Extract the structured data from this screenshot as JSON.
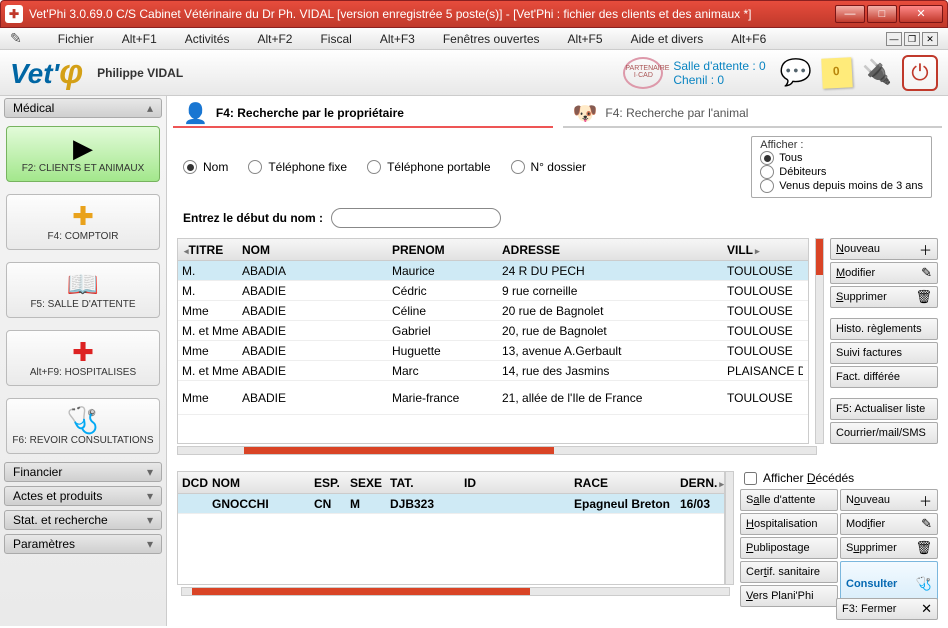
{
  "window": {
    "title": "Vet'Phi 3.0.69.0 C/S  Cabinet Vétérinaire du Dr Ph. VIDAL  [version enregistrée 5 poste(s)] - [Vet'Phi : fichier des clients et des animaux *]"
  },
  "menu": {
    "fichier": "Fichier",
    "alt_f1": "Alt+F1",
    "activites": "Activités",
    "alt_f2": "Alt+F2",
    "fiscal": "Fiscal",
    "alt_f3": "Alt+F3",
    "fenetres": "Fenêtres ouvertes",
    "alt_f5": "Alt+F5",
    "aide": "Aide et divers",
    "alt_f6": "Alt+F6"
  },
  "brand": {
    "logo1": "Vet'",
    "logo2": "φ",
    "user": "Philippe VIDAL",
    "salle": "Salle d'attente : 0",
    "chenil": "Chenil : 0"
  },
  "sidebar": {
    "medical": "Médical",
    "clients": "F2: CLIENTS ET ANIMAUX",
    "comptoir": "F4: COMPTOIR",
    "salle": "F5: SALLE D'ATTENTE",
    "hospit": "Alt+F9: HOSPITALISES",
    "revoir": "F6: REVOIR CONSULTATIONS",
    "financier": "Financier",
    "actes": "Actes et produits",
    "stat": "Stat. et recherche",
    "param": "Paramètres"
  },
  "search": {
    "tab1": "F4:  Recherche par le propriétaire",
    "tab2": "F4: Recherche par l'animal",
    "nom": "Nom",
    "telfixe": "Téléphone fixe",
    "telport": "Téléphone portable",
    "dossier": "N° dossier",
    "entrez": "Entrez le début du nom :",
    "afficher_lgd": "Afficher :",
    "tous": "Tous",
    "debit": "Débiteurs",
    "venus": "Venus depuis moins de 3 ans"
  },
  "clients_table": {
    "headers": {
      "titre": "TITRE",
      "nom": "NOM",
      "prenom": "PRENOM",
      "adresse": "ADRESSE",
      "ville": "VILL"
    },
    "rows": [
      {
        "titre": "M.",
        "nom": "ABADIA",
        "prenom": "Maurice",
        "adresse": "24 R DU PECH",
        "ville": "TOULOUSE"
      },
      {
        "titre": "M.",
        "nom": "ABADIE",
        "prenom": "Cédric",
        "adresse": "9 rue corneille",
        "ville": "TOULOUSE"
      },
      {
        "titre": "Mme",
        "nom": "ABADIE",
        "prenom": "Céline",
        "adresse": "20 rue de Bagnolet",
        "ville": "TOULOUSE"
      },
      {
        "titre": "M. et Mme",
        "nom": "ABADIE",
        "prenom": "Gabriel",
        "adresse": "20, rue de Bagnolet",
        "ville": "TOULOUSE"
      },
      {
        "titre": "Mme",
        "nom": "ABADIE",
        "prenom": "Huguette",
        "adresse": "13, avenue A.Gerbault",
        "ville": "TOULOUSE"
      },
      {
        "titre": "M. et Mme",
        "nom": "ABADIE",
        "prenom": "Marc",
        "adresse": "14, rue des Jasmins",
        "ville": "PLAISANCE DU"
      },
      {
        "titre": "Mme",
        "nom": "ABADIE",
        "prenom": "Marie-france",
        "adresse": "21, allée de l'Ile de France",
        "ville": "TOULOUSE"
      }
    ]
  },
  "client_actions": {
    "nouveau": "Nouveau",
    "modifier": "Modifier",
    "supprimer": "Supprimer",
    "histo": "Histo. règlements",
    "suivi": "Suivi factures",
    "fact": "Fact. différée",
    "actualiser": "F5: Actualiser liste",
    "courrier": "Courrier/mail/SMS"
  },
  "animals_table": {
    "headers": {
      "dcd": "DCD",
      "nom": "NOM",
      "esp": "ESP.",
      "sexe": "SEXE",
      "tat": "TAT.",
      "id": "ID",
      "race": "RACE",
      "dern": "DERN."
    },
    "rows": [
      {
        "dcd": "",
        "nom": "GNOCCHI",
        "esp": "CN",
        "sexe": "M",
        "tat": "DJB323",
        "id": "",
        "race": "Epagneul Breton",
        "dern": "16/03"
      }
    ]
  },
  "animal_actions": {
    "afficher_dec": "Afficher Décédés",
    "salle": "Salle d'attente",
    "nouveau": "Nouveau",
    "hosp": "Hospitalisation",
    "modifier": "Modifier",
    "publi": "Publipostage",
    "supprimer": "Supprimer",
    "certif": "Certif. sanitaire",
    "consulter": "Consulter",
    "planiphi": "Vers Plani'Phi"
  },
  "footer": {
    "fermer": "F3: Fermer"
  }
}
